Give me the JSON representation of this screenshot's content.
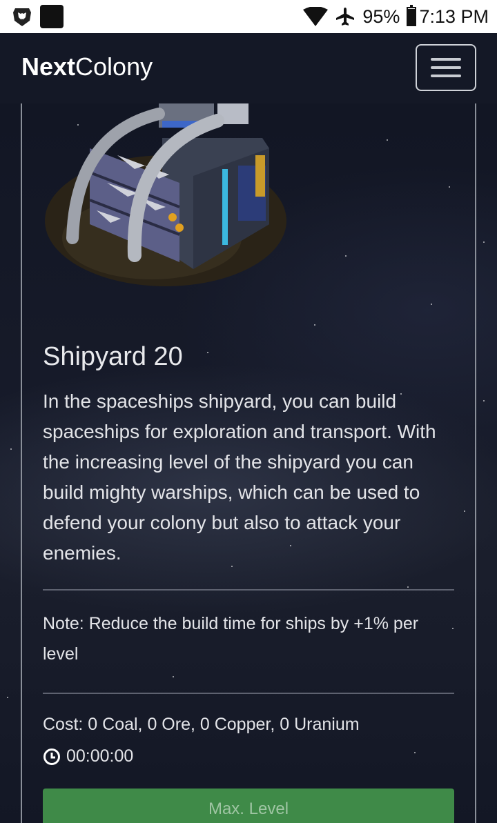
{
  "status_bar": {
    "battery": "95%",
    "time": "7:13 PM",
    "battery_level": 0.95
  },
  "navbar": {
    "brand_bold": "Next",
    "brand_rest": "Colony"
  },
  "building": {
    "title": "Shipyard 20",
    "description": "In the spaceships shipyard, you can build spaceships for exploration and transport. With the increasing level of the shipyard you can build mighty warships, which can be used to defend your colony but also to attack your enemies.",
    "note": "Note: Reduce the build time for ships by +1% per level",
    "cost": "Cost: 0 Coal, 0 Ore, 0 Copper, 0 Uranium",
    "time": "00:00:00",
    "button_label": "Max. Level"
  },
  "colors": {
    "button_bg": "#3f8a48",
    "page_bg": "#10131e"
  }
}
